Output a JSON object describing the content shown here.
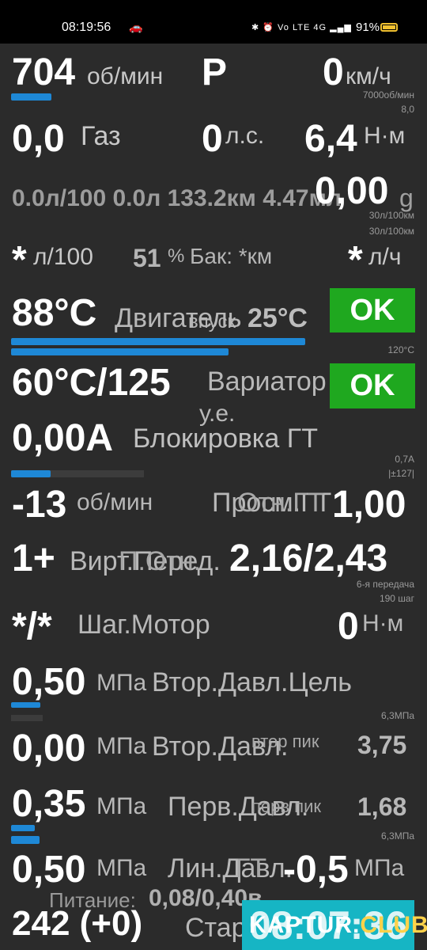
{
  "status_bar": {
    "time": "08:19:56",
    "network": "Vo LTE 4G",
    "battery": "91%"
  },
  "rows": {
    "rpm": {
      "value": "704",
      "unit": "об/мин",
      "gear": "P",
      "speed": "0",
      "speed_unit": "км/ч",
      "max_label": "7000об/мин",
      "small_val": "8,0",
      "bar_fraction": 0.1
    },
    "gas": {
      "value": "0,0",
      "label": "Газ",
      "power": "0",
      "power_unit": "л.с.",
      "torque": "6,4",
      "torque_unit": "Н·м"
    },
    "fuel": {
      "text": "0.0л/100 0.0л 133.2км 4.47мл",
      "big_value": "0,00",
      "g_unit": "g",
      "small_1": "30л/100км",
      "small_2": "30л/100км"
    },
    "tank": {
      "consumption": "*",
      "consumption_unit": "л/100",
      "percent": "51",
      "percent_unit": "%",
      "tank_label": "Бак: *км",
      "hourly": "*",
      "hourly_unit": "л/ч"
    },
    "engine": {
      "temp": "88°C",
      "label": "Двигатель",
      "overlay_label": "впуск",
      "intake_temp": "25°C",
      "status": "OK",
      "max_label": "120°C",
      "bar_fraction_1": 0.73,
      "bar_fraction_2": 0.54
    },
    "cvt": {
      "temp": "60°C/125",
      "label": "Вариатор",
      "sub_label": "у.е.",
      "status": "OK"
    },
    "lockup": {
      "value": "0,00A",
      "label": "Блокировка ГТ",
      "small_1": "0,7A",
      "small_2": "|±127|",
      "bar_fraction": 0.3
    },
    "slip": {
      "value": "-13",
      "unit": "об/мин",
      "label": "Просм.ГТ",
      "overlay_label": "Отн.ГТ",
      "ratio": "1,00"
    },
    "gear_ratio": {
      "value": "1+",
      "label": "Вирт.Перед.",
      "overlay_label": "П.Отн.",
      "ratio": "2,16/2,43",
      "small_1": "6-я передача",
      "small_2": "190 шаг"
    },
    "stepper": {
      "value": "*/*",
      "label": "Шаг.Мотор",
      "torque": "0",
      "torque_unit": "Н·м"
    },
    "sec_target": {
      "value": "0,50",
      "unit": "МПа",
      "label": "Втор.Давл.Цель",
      "max_label": "6,3МПа",
      "bar_fraction": 0.27
    },
    "sec_press": {
      "value": "0,00",
      "unit": "МПа",
      "label": "Втор.Давл.",
      "overlay_label": "втор пик",
      "peak": "3,75"
    },
    "prim_press": {
      "value": "0,35",
      "unit": "МПа",
      "label": "Перв.Давл.",
      "overlay_label": "перв пик",
      "peak": "1,68",
      "max_label": "6,3МПа",
      "bar_fraction": 0.1
    },
    "line_press": {
      "value": "0,50",
      "unit": "МПа",
      "label": "Лин.Давл.",
      "overlay_label": "ГТ",
      "line_value": "-0,5",
      "line_unit": "МПа"
    },
    "power_supply": {
      "label": "Питание:",
      "value": "0,08/0,40в"
    },
    "starter": {
      "value": "242 (+0)",
      "label": "Старт",
      "clock": "08:07:36"
    }
  },
  "watermark": {
    "brand": "KAPTUR",
    "dot": ".",
    "club": "CLUB"
  },
  "colors": {
    "background": "#2b2b2b",
    "bar": "#1e88d6",
    "ok": "#1fa81f",
    "clock": "#16b5c4"
  }
}
